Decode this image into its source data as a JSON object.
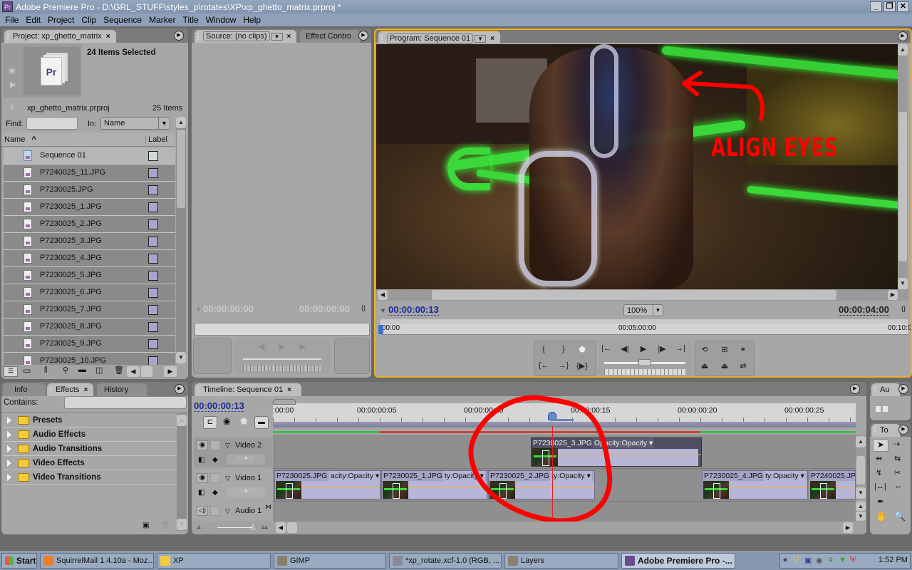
{
  "window": {
    "title": "Adobe Premiere Pro - D:\\GRL_STUFF\\styles_p\\rotates\\XP\\xp_ghetto_matrix.prproj *",
    "app_icon": "Pr",
    "controls": [
      "minimize",
      "restore",
      "close"
    ]
  },
  "menu": [
    "File",
    "Edit",
    "Project",
    "Clip",
    "Sequence",
    "Marker",
    "Title",
    "Window",
    "Help"
  ],
  "project_panel": {
    "tab_label": "Project: xp_ghetto_matrix",
    "selection_text": "24 Items Selected",
    "project_file": "xp_ghetto_matrix.prproj",
    "item_count": "25 Items",
    "find_label": "Find:",
    "find_value": "",
    "in_label": "In:",
    "in_value": "Name",
    "columns": {
      "name": "Name",
      "label": "Label"
    },
    "items": [
      {
        "name": "Sequence 01",
        "type": "sequence"
      },
      {
        "name": "P7240025_11.JPG",
        "type": "image"
      },
      {
        "name": "P7230025.JPG",
        "type": "image"
      },
      {
        "name": "P7230025_1.JPG",
        "type": "image"
      },
      {
        "name": "P7230025_2.JPG",
        "type": "image"
      },
      {
        "name": "P7230025_3.JPG",
        "type": "image"
      },
      {
        "name": "P7230025_4.JPG",
        "type": "image"
      },
      {
        "name": "P7230025_5.JPG",
        "type": "image"
      },
      {
        "name": "P7230025_6.JPG",
        "type": "image"
      },
      {
        "name": "P7230025_7.JPG",
        "type": "image"
      },
      {
        "name": "P7230025_8.JPG",
        "type": "image"
      },
      {
        "name": "P7230025_9.JPG",
        "type": "image"
      },
      {
        "name": "P7230025_10.JPG",
        "type": "image"
      }
    ]
  },
  "source_panel": {
    "tab_label": "Source: (no clips)",
    "tab2_label": "Effect Contro",
    "timecode_left": "00:00:00:00",
    "timecode_right": "00:00:00:00"
  },
  "program_panel": {
    "tab_label": "Program: Sequence 01",
    "current_timecode": "00:00:00:13",
    "zoom": "100%",
    "duration": "00:00:04:00",
    "ruler_ticks": [
      "00:00",
      "00:05:00:00",
      "00:10:0"
    ],
    "annotation_text": "ALIGN EYES",
    "annotation_color": "#ff0000"
  },
  "effects_panel": {
    "tabs": [
      "Info",
      "Effects",
      "History"
    ],
    "active_tab": "Effects",
    "contains_label": "Contains:",
    "contains_value": "",
    "folders": [
      "Presets",
      "Audio Effects",
      "Audio Transitions",
      "Video Effects",
      "Video Transitions"
    ]
  },
  "timeline_panel": {
    "tab_label": "Timeline: Sequence 01",
    "current_timecode": "00:00:00:13",
    "ruler_labels": [
      ":00:00",
      "00:00:00:05",
      "00:00:00:10",
      "00:00:00:15",
      "00:00:00:20",
      "00:00:00:25"
    ],
    "tracks": [
      {
        "name": "Video 2",
        "clips": [
          {
            "title": "P7230025_3.JPG",
            "fx": "Opacity:Opacity"
          }
        ]
      },
      {
        "name": "Video 1",
        "clips": [
          {
            "title": "P7230025.JPG",
            "fx": "acity:Opacity"
          },
          {
            "title": "P7230025_1.JPG",
            "fx": "ty:Opacity"
          },
          {
            "title": "P7230025_2.JPG",
            "fx": "ty:Opacity"
          },
          {
            "title": "P7230025_4.JPG",
            "fx": "ty:Opacity"
          },
          {
            "title": "P7240025.JP",
            "fx": ""
          }
        ]
      },
      {
        "name": "Audio 1",
        "clips": []
      }
    ]
  },
  "audio_panel": {
    "tab_label": "Au"
  },
  "tools_panel": {
    "tab_label": "To",
    "tools": [
      "selection",
      "track-select",
      "ripple-edit",
      "rolling-edit",
      "rate-stretch",
      "razor",
      "slip",
      "slide",
      "pen",
      "hand",
      "zoom"
    ]
  },
  "taskbar": {
    "start_label": "Start",
    "tasks": [
      {
        "label": "SquirrelMail 1.4.10a - Moz...",
        "icon": "firefox-icon",
        "active": false
      },
      {
        "label": "XP",
        "icon": "folder-icon",
        "active": false
      },
      {
        "label": "GIMP",
        "icon": "gimp-icon",
        "active": false
      },
      {
        "label": "*xp_rotate.xcf-1.0 (RGB, ...",
        "icon": "image-icon",
        "active": false
      },
      {
        "label": "Layers",
        "icon": "gimp-icon",
        "active": false
      },
      {
        "label": "Adobe Premiere Pro -...",
        "icon": "premiere-icon",
        "active": true
      }
    ],
    "clock": "1:52 PM",
    "tray_expand": "«"
  }
}
